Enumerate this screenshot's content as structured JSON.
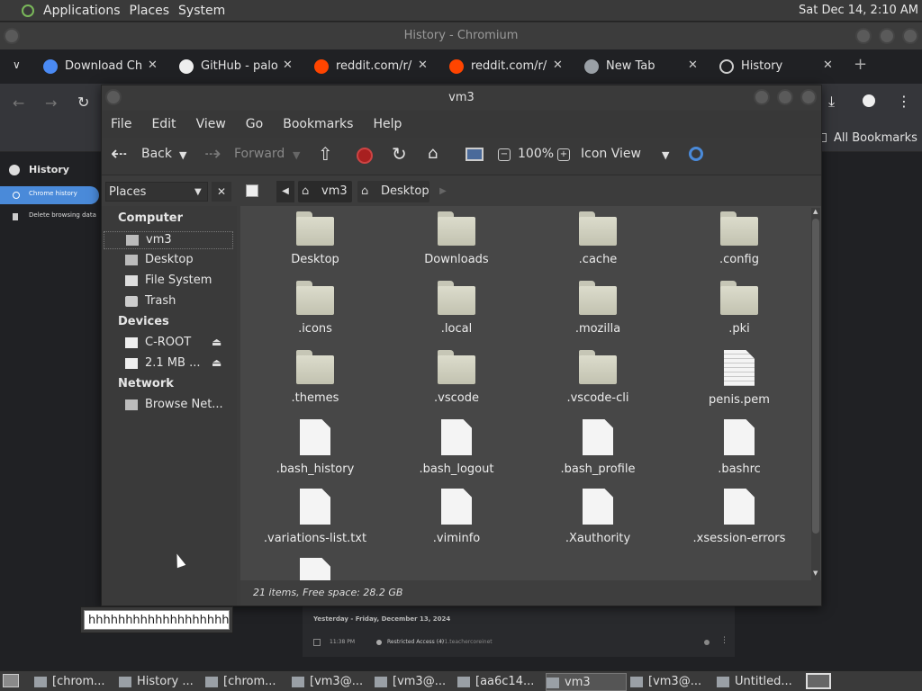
{
  "top_panel": {
    "menus": [
      "Applications",
      "Places",
      "System"
    ],
    "clock": "Sat Dec 14,  2:10 AM"
  },
  "chromium": {
    "title": "History - Chromium",
    "tabs": [
      {
        "label": "Download Ch",
        "icon": "chrome-icon"
      },
      {
        "label": "GitHub - palo",
        "icon": "github-icon"
      },
      {
        "label": "reddit.com/r/",
        "icon": "reddit-icon"
      },
      {
        "label": "reddit.com/r/",
        "icon": "reddit-icon"
      },
      {
        "label": "New Tab",
        "icon": "globe-icon"
      },
      {
        "label": "History",
        "icon": "history-icon"
      }
    ],
    "bookmarks_label": "All Bookmarks",
    "history_sidebar": {
      "title": "History",
      "items": [
        "Chrome history",
        "Delete browsing data"
      ]
    },
    "history_card": {
      "date_header": "Yesterday - Friday, December 13, 2024",
      "time": "11:38 PM",
      "entry_title": "Restricted Access (4)",
      "entry_url": "v1.teachercoreinet"
    }
  },
  "nautilus": {
    "title": "vm3",
    "menu": [
      "File",
      "Edit",
      "View",
      "Go",
      "Bookmarks",
      "Help"
    ],
    "toolbar": {
      "back": "Back",
      "forward": "Forward",
      "zoom": "100%",
      "view_mode": "Icon View"
    },
    "sidebar_selector": "Places",
    "breadcrumb": [
      "vm3",
      "Desktop"
    ],
    "places": {
      "sections": [
        {
          "title": "Computer",
          "items": [
            {
              "label": "vm3",
              "icon": "home-icon"
            },
            {
              "label": "Desktop",
              "icon": "desktop-icon"
            },
            {
              "label": "File System",
              "icon": "drive-icon"
            },
            {
              "label": "Trash",
              "icon": "trash-icon"
            }
          ]
        },
        {
          "title": "Devices",
          "items": [
            {
              "label": "C-ROOT",
              "icon": "drive-icon"
            },
            {
              "label": "2.1 MB ...",
              "icon": "drive-icon"
            }
          ]
        },
        {
          "title": "Network",
          "items": [
            {
              "label": "Browse Net...",
              "icon": "network-icon"
            }
          ]
        }
      ]
    },
    "files": [
      {
        "name": "Desktop",
        "type": "folder"
      },
      {
        "name": "Downloads",
        "type": "folder"
      },
      {
        "name": ".cache",
        "type": "folder"
      },
      {
        "name": ".config",
        "type": "folder"
      },
      {
        "name": ".icons",
        "type": "folder"
      },
      {
        "name": ".local",
        "type": "folder"
      },
      {
        "name": ".mozilla",
        "type": "folder"
      },
      {
        "name": ".pki",
        "type": "folder"
      },
      {
        "name": ".themes",
        "type": "folder"
      },
      {
        "name": ".vscode",
        "type": "folder"
      },
      {
        "name": ".vscode-cli",
        "type": "folder"
      },
      {
        "name": "penis.pem",
        "type": "text"
      },
      {
        "name": ".bash_history",
        "type": "file"
      },
      {
        "name": ".bash_logout",
        "type": "file"
      },
      {
        "name": ".bash_profile",
        "type": "file"
      },
      {
        "name": ".bashrc",
        "type": "file"
      },
      {
        "name": ".variations-list.txt",
        "type": "file"
      },
      {
        "name": ".viminfo",
        "type": "file"
      },
      {
        "name": ".Xauthority",
        "type": "file"
      },
      {
        "name": ".xsession-errors",
        "type": "file"
      },
      {
        "name": "",
        "type": "file"
      }
    ],
    "status": "21 items, Free space: 28.2 GB"
  },
  "rename_input": {
    "value": "hhhhhhhhhhhhhhhhhhh"
  },
  "taskbar": {
    "items": [
      {
        "label": "[chrom..."
      },
      {
        "label": "History ..."
      },
      {
        "label": "[chrom..."
      },
      {
        "label": "[vm3@..."
      },
      {
        "label": "[vm3@..."
      },
      {
        "label": "[aa6c14..."
      },
      {
        "label": "vm3"
      },
      {
        "label": "[vm3@..."
      },
      {
        "label": "Untitled..."
      }
    ]
  }
}
